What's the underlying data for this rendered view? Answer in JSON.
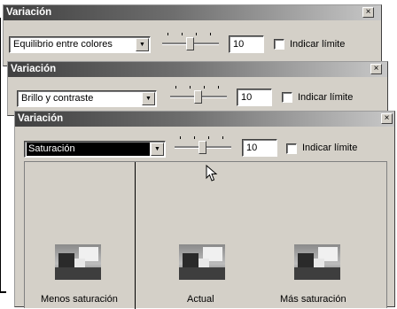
{
  "close_glyph": "×",
  "arrow_glyph": "▼",
  "windows": [
    {
      "title": "Variación",
      "select_value": "Equilibrio entre colores",
      "number_value": "10",
      "checkbox_label": "Indicar límite"
    },
    {
      "title": "Variación",
      "select_value": "Brillo y contraste",
      "number_value": "10",
      "checkbox_label": "Indicar límite"
    },
    {
      "title": "Variación",
      "select_value": "Saturación",
      "number_value": "10",
      "checkbox_label": "Indicar límite"
    }
  ],
  "previews": [
    {
      "caption": "Menos saturación"
    },
    {
      "caption": "Actual"
    },
    {
      "caption": "Más saturación"
    }
  ],
  "icons": {
    "close": "close-icon",
    "dropdown": "chevron-down-icon",
    "cursor": "mouse-pointer-icon"
  },
  "colors": {
    "title_dark": "#404040",
    "title_light": "#c8c8c8",
    "face": "#d4d0c8",
    "selection": "#000000"
  }
}
